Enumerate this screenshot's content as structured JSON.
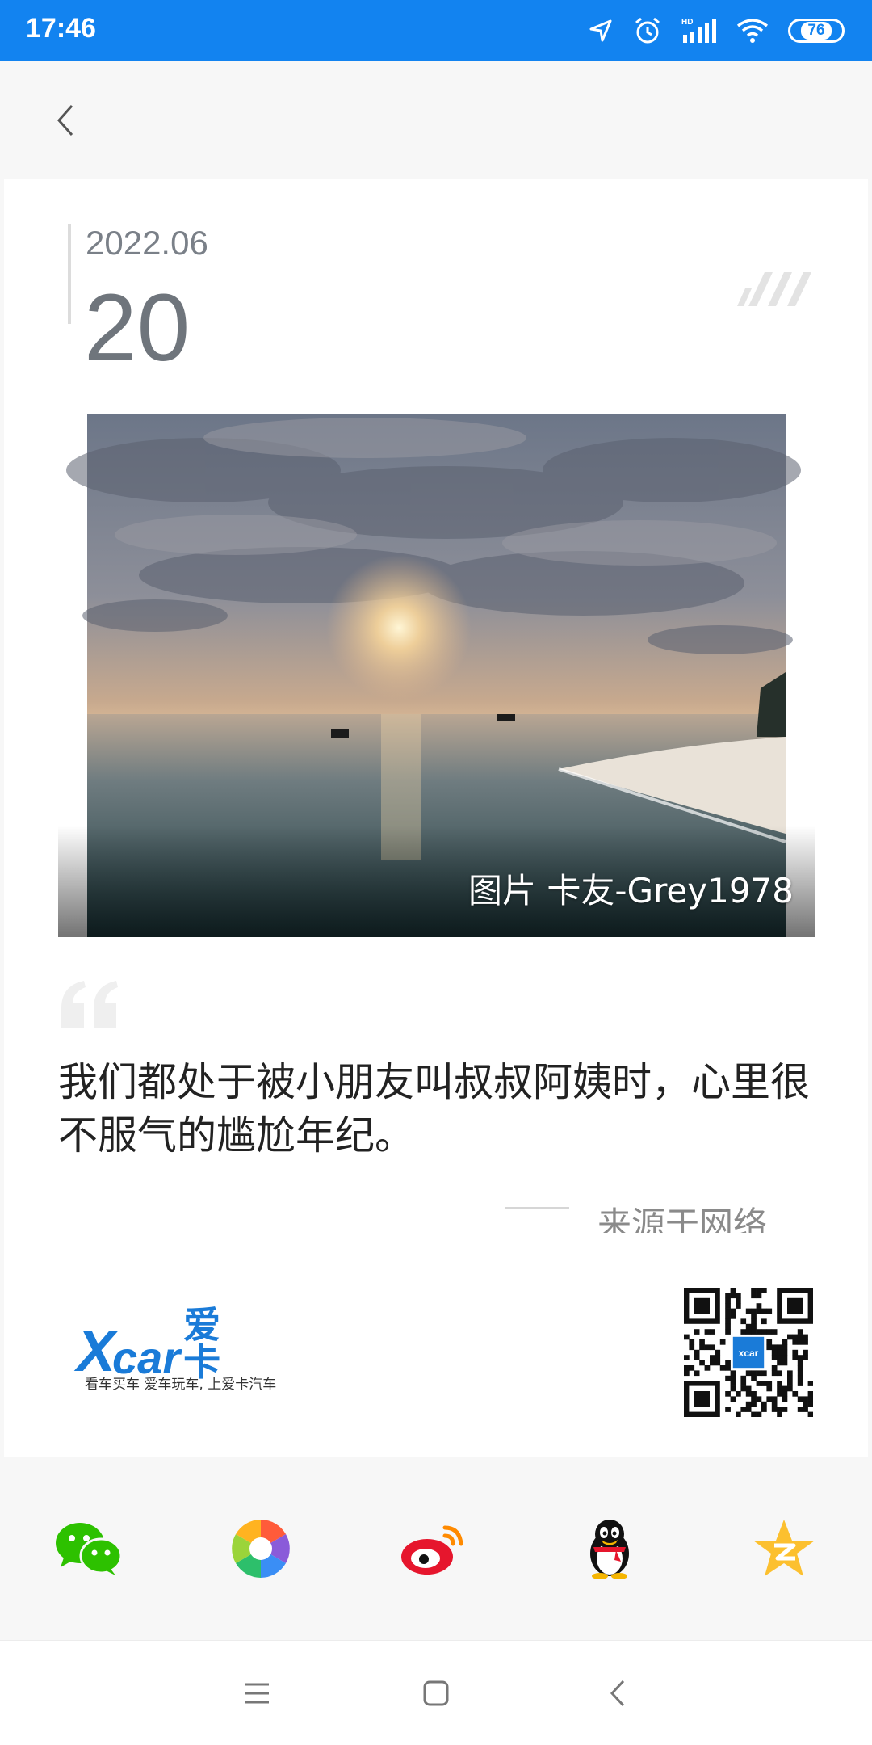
{
  "status_bar": {
    "time": "17:46",
    "battery": "76",
    "icons": [
      "location-icon",
      "alarm-icon",
      "signal-icon",
      "wifi-icon",
      "battery-icon"
    ]
  },
  "header": {
    "back_icon": "chevron-left-icon"
  },
  "card": {
    "date_year_month": "2022.06",
    "date_day": "20",
    "photo_credit": "图片 卡友-Grey1978",
    "quote": "我们都处于被小朋友叫叔叔阿姨时，心里很不服气的尴尬年纪。",
    "source": "来源于网络",
    "brand": {
      "logo_x": "X",
      "logo_car": "car",
      "logo_cn": "爱卡",
      "slogan": "看车买车 爱车玩车, 上爱卡汽车"
    },
    "qr_badge": "xcar"
  },
  "share": [
    {
      "name": "wechat",
      "icon": "wechat-icon",
      "color": "#2dc100"
    },
    {
      "name": "moments",
      "icon": "moments-icon",
      "color": "#ff9c00"
    },
    {
      "name": "weibo",
      "icon": "weibo-icon",
      "color": "#e6162d"
    },
    {
      "name": "qq",
      "icon": "qq-icon",
      "color": "#111111"
    },
    {
      "name": "qzone",
      "icon": "qzone-icon",
      "color": "#fcc02f"
    }
  ],
  "nav": [
    "menu-icon",
    "home-icon",
    "back-icon"
  ],
  "colors": {
    "status_bar": "#1283f0",
    "brand": "#1a7bd8"
  }
}
